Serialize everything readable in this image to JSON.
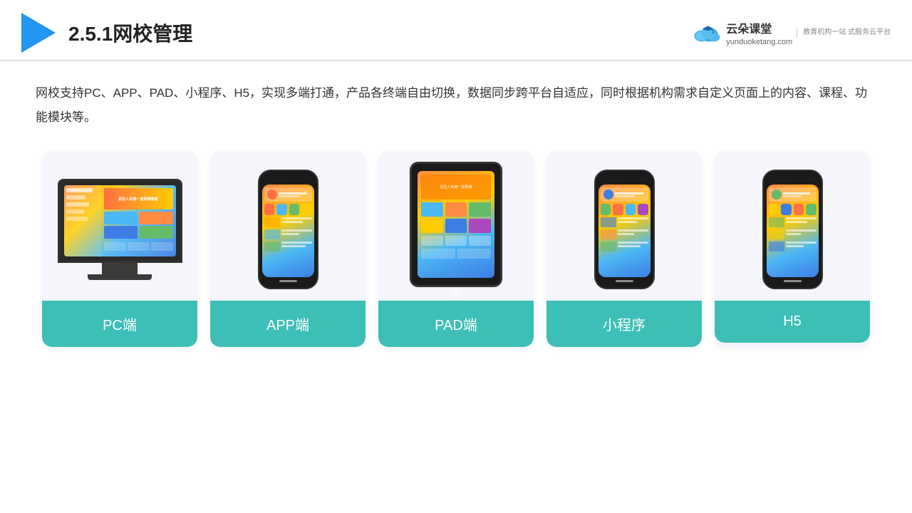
{
  "header": {
    "title": "2.5.1网校管理",
    "brand_name": "云朵课堂",
    "brand_url": "yunduoketang.com",
    "brand_tagline": "教育机构一站\n式服务云平台"
  },
  "description": {
    "text": "网校支持PC、APP、PAD、小程序、H5，实现多端打通，产品各终端自由切换，数据同步跨平台自适应，同时根据机构需求自定义页面上的内容、课程、功能模块等。"
  },
  "cards": [
    {
      "id": "pc",
      "label": "PC端"
    },
    {
      "id": "app",
      "label": "APP端"
    },
    {
      "id": "pad",
      "label": "PAD端"
    },
    {
      "id": "miniprogram",
      "label": "小程序"
    },
    {
      "id": "h5",
      "label": "H5"
    }
  ],
  "colors": {
    "accent": "#3dbfb8",
    "header_border": "#e0e0e0",
    "card_bg": "#f4f6fb",
    "title_color": "#222222",
    "text_color": "#333333"
  }
}
